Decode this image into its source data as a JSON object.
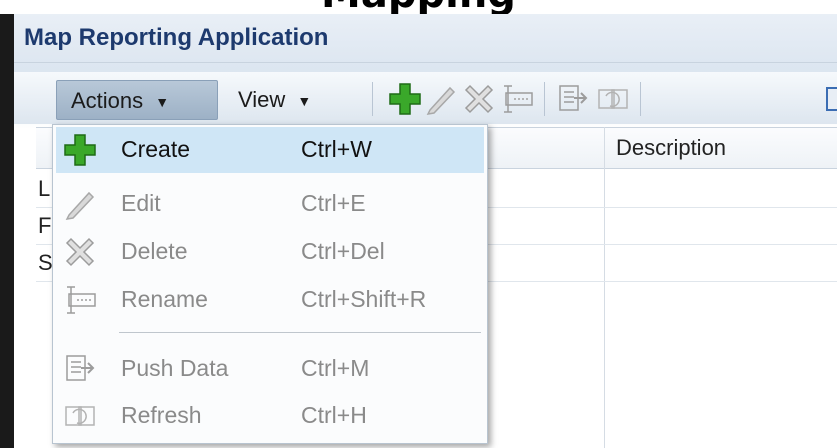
{
  "page": {
    "partial_heading": "Mapping"
  },
  "app": {
    "title": "Map Reporting Application"
  },
  "menubar": {
    "actions_label": "Actions",
    "view_label": "View"
  },
  "toolbar": {
    "icons": [
      "add-icon",
      "edit-icon",
      "delete-icon",
      "rename-icon",
      "push-data-icon",
      "refresh-icon",
      "export-icon"
    ]
  },
  "table": {
    "columns": [
      "",
      "Description"
    ],
    "rows": [
      {
        "first_char": "L",
        "description": ""
      },
      {
        "first_char": "F",
        "description": ""
      },
      {
        "first_char": "S",
        "description": ""
      }
    ]
  },
  "actions_menu": {
    "items": [
      {
        "label": "Create",
        "shortcut": "Ctrl+W",
        "icon": "add-icon",
        "enabled": true,
        "highlighted": true
      },
      {
        "label": "Edit",
        "shortcut": "Ctrl+E",
        "icon": "pencil-icon",
        "enabled": false
      },
      {
        "label": "Delete",
        "shortcut": "Ctrl+Del",
        "icon": "delete-x-icon",
        "enabled": false
      },
      {
        "label": "Rename",
        "shortcut": "Ctrl+Shift+R",
        "icon": "rename-icon",
        "enabled": false
      },
      {
        "label": "Push Data",
        "shortcut": "Ctrl+M",
        "icon": "push-data-icon",
        "enabled": false
      },
      {
        "label": "Refresh",
        "shortcut": "Ctrl+H",
        "icon": "refresh-icon",
        "enabled": false
      }
    ]
  },
  "colors": {
    "title": "#1d3a6e",
    "highlight": "#cfe6f6",
    "add_green": "#3aa82a"
  }
}
